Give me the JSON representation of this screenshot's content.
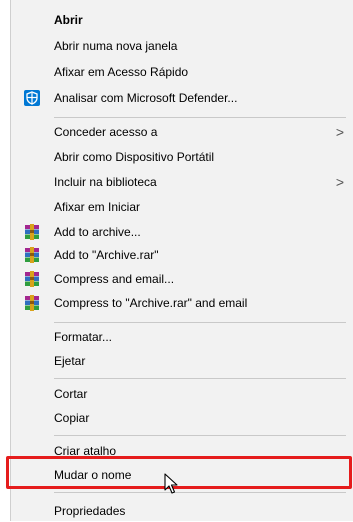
{
  "context_menu": {
    "items": [
      {
        "label": "Abrir",
        "bold": true,
        "icon": null,
        "submenu": false
      },
      {
        "label": "Abrir numa nova janela",
        "icon": null,
        "submenu": false
      },
      {
        "label": "Afixar em Acesso Rápido",
        "icon": null,
        "submenu": false
      },
      {
        "label": "Analisar com Microsoft Defender...",
        "icon": "defender-shield-icon",
        "submenu": false
      },
      {
        "label": "Conceder acesso a",
        "icon": null,
        "submenu": true
      },
      {
        "label": "Abrir como Dispositivo Portátil",
        "icon": null,
        "submenu": false
      },
      {
        "label": "Incluir na biblioteca",
        "icon": null,
        "submenu": true
      },
      {
        "label": "Afixar em Iniciar",
        "icon": null,
        "submenu": false
      },
      {
        "label": "Add to archive...",
        "icon": "winrar-icon",
        "submenu": false
      },
      {
        "label": "Add to \"Archive.rar\"",
        "icon": "winrar-icon",
        "submenu": false
      },
      {
        "label": "Compress and email...",
        "icon": "winrar-icon",
        "submenu": false
      },
      {
        "label": "Compress to \"Archive.rar\" and email",
        "icon": "winrar-icon",
        "submenu": false
      },
      {
        "label": "Formatar...",
        "icon": null,
        "submenu": false
      },
      {
        "label": "Ejetar",
        "icon": null,
        "submenu": false
      },
      {
        "label": "Cortar",
        "icon": null,
        "submenu": false
      },
      {
        "label": "Copiar",
        "icon": null,
        "submenu": false
      },
      {
        "label": "Criar atalho",
        "icon": null,
        "submenu": false
      },
      {
        "label": "Mudar o nome",
        "icon": null,
        "submenu": false,
        "highlighted": true
      },
      {
        "label": "Propriedades",
        "icon": null,
        "submenu": false
      }
    ],
    "submenu_arrow": ">"
  },
  "colors": {
    "menu_background": "#f2f2f2",
    "highlight_border": "#e51c1c",
    "defender_blue": "#0078d4"
  }
}
